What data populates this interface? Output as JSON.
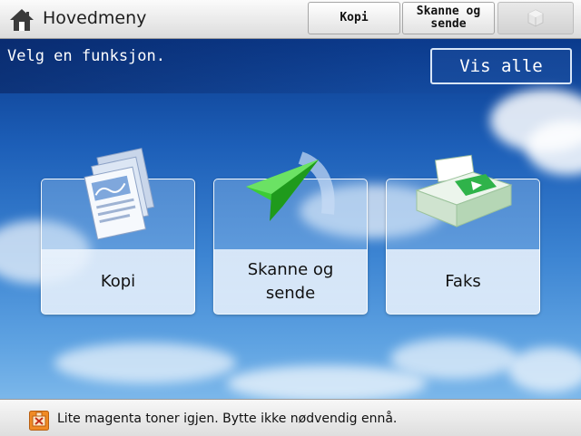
{
  "header": {
    "title": "Hovedmeny",
    "home_icon": "home-icon",
    "buttons": [
      {
        "label": "Kopi"
      },
      {
        "label": "Skanne og\nsende"
      },
      {
        "label": "",
        "icon": "disabled-app-icon",
        "disabled": true
      }
    ]
  },
  "main": {
    "instruction": "Velg en funksjon.",
    "show_all_label": "Vis alle",
    "tiles": [
      {
        "label": "Kopi",
        "icon": "copy-documents-icon"
      },
      {
        "label": "Skanne og\nsende",
        "icon": "paper-plane-icon"
      },
      {
        "label": "Faks",
        "icon": "fax-machine-icon"
      }
    ]
  },
  "status": {
    "icon": "toner-warning-icon",
    "message": "Lite magenta toner igjen. Bytte ikke nødvendig ennå."
  },
  "colors": {
    "sky_top": "#0a3a8c",
    "sky_bottom": "#7bb7ea",
    "plane_green": "#2fc02a",
    "warning_orange": "#f08a24"
  }
}
